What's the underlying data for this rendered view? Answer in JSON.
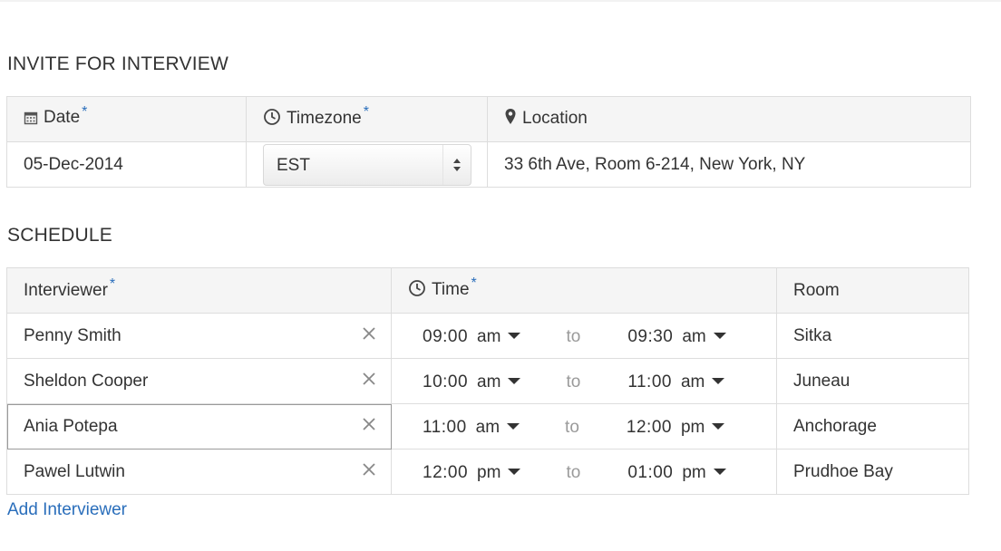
{
  "invite": {
    "title": "INVITE FOR INTERVIEW",
    "headers": {
      "date": "Date",
      "timezone": "Timezone",
      "location": "Location"
    },
    "required_mark": "*",
    "date_value": "05-Dec-2014",
    "timezone_value": "EST",
    "location_value": "33 6th Ave, Room 6-214, New York, NY"
  },
  "schedule": {
    "title": "SCHEDULE",
    "headers": {
      "interviewer": "Interviewer",
      "time": "Time",
      "room": "Room"
    },
    "to_label": "to",
    "rows": [
      {
        "name": "Penny Smith",
        "start": "09:00",
        "start_ampm": "am",
        "end": "09:30",
        "end_ampm": "am",
        "room": "Sitka"
      },
      {
        "name": "Sheldon Cooper",
        "start": "10:00",
        "start_ampm": "am",
        "end": "11:00",
        "end_ampm": "am",
        "room": "Juneau"
      },
      {
        "name": "Ania Potepa",
        "start": "11:00",
        "start_ampm": "am",
        "end": "12:00",
        "end_ampm": "pm",
        "room": "Anchorage"
      },
      {
        "name": "Pawel Lutwin",
        "start": "12:00",
        "start_ampm": "pm",
        "end": "01:00",
        "end_ampm": "pm",
        "room": "Prudhoe Bay"
      }
    ]
  },
  "add_interviewer_label": "Add Interviewer",
  "colors": {
    "link": "#2a6ebb",
    "border": "#dddddd",
    "header_bg": "#f5f5f5",
    "muted": "#9a9a9a"
  },
  "icons": [
    "calendar-icon",
    "clock-icon",
    "map-marker-icon",
    "select-arrows-icon",
    "remove-icon",
    "caret-down-icon"
  ]
}
